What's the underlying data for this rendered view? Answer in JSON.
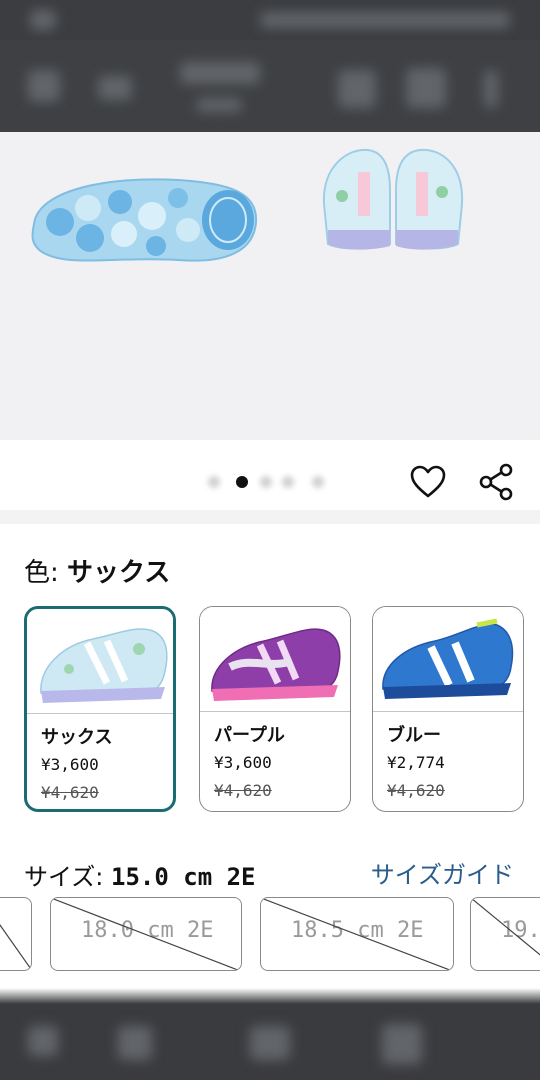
{
  "color_section": {
    "label": "色:",
    "selected_value": "サックス",
    "options": [
      {
        "name": "サックス",
        "price": "¥3,600",
        "old_price": "¥4,620",
        "selected": true,
        "swatch": "#bfe3f2"
      },
      {
        "name": "パープル",
        "price": "¥3,600",
        "old_price": "¥4,620",
        "selected": false,
        "swatch": "#8e3ea8"
      },
      {
        "name": "ブルー",
        "price": "¥2,774",
        "old_price": "¥4,620",
        "selected": false,
        "swatch": "#2f78cf"
      }
    ]
  },
  "size_section": {
    "label": "サイズ:",
    "selected_value": "15.0 cm 2E",
    "guide_link": "サイズガイド",
    "chips": [
      {
        "label": "18.0 cm 2E",
        "available": false
      },
      {
        "label": "18.5 cm 2E",
        "available": false
      },
      {
        "label": "19.",
        "available": false
      }
    ]
  },
  "icons": {
    "favorite": "heart-icon",
    "share": "share-icon"
  },
  "colors": {
    "accent_selected": "#1b6c72",
    "link": "#2a5d8c"
  }
}
